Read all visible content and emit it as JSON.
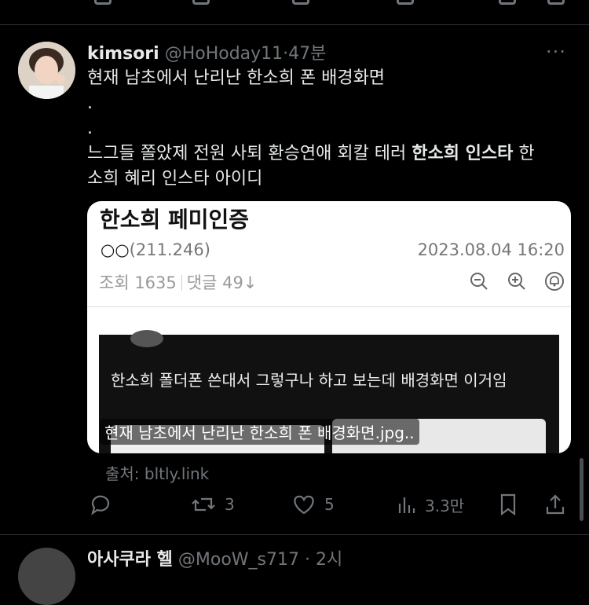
{
  "tweet": {
    "name": "kimsori",
    "handle": "@HoHoday11",
    "dot": "·",
    "time": "47분",
    "more": "···",
    "line1": "현재 남초에서 난리난 한소희 폰 배경화면",
    "line2": ".",
    "line3": ".",
    "line4_a": "느그들 쫄았제 전원 사퇴 환승연애 회칼 테러 ",
    "line4_b": "한소희 인스타",
    "line4_c": " 한",
    "line5": "소희 혜리 인스타 아이디"
  },
  "card": {
    "title": "한소희 페미인증",
    "author_oo": "○○",
    "author_ip": "(211.246)",
    "date": "2023.08.04 16:20",
    "views": "조회 1635",
    "comments": "댓글 49↓",
    "dark_text": "한소희 폴더폰 쓴대서 그렇구나 하고 보는데 배경화면 이거임",
    "caption": "현재 남초에서 난리난 한소희 폰 배경화면.jpg.."
  },
  "source": "출처: bltly.link",
  "actions": {
    "reposts": "3",
    "likes": "5",
    "views": "3.3만"
  },
  "next_tweet": {
    "name": "아사쿠라 헬",
    "handle": "@MooW_s717",
    "time": "· 2시"
  }
}
